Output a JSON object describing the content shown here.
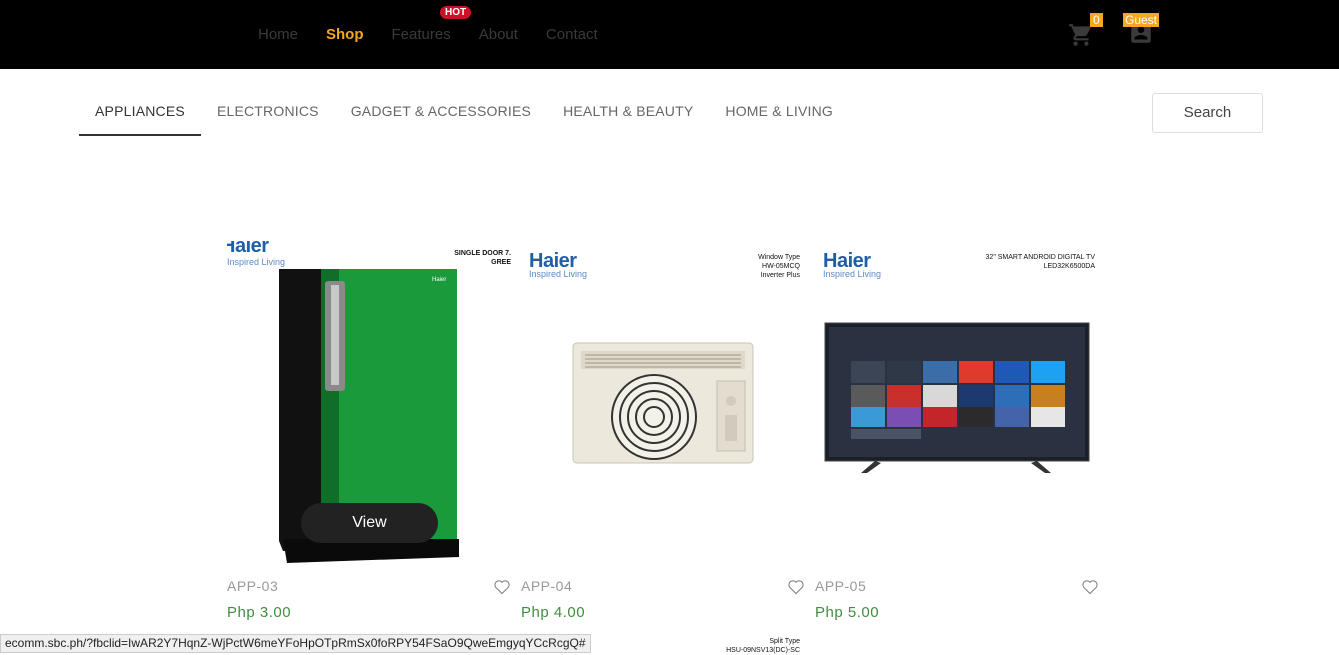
{
  "nav": {
    "items": [
      {
        "label": "Home"
      },
      {
        "label": "Shop"
      },
      {
        "label": "Features"
      },
      {
        "label": "About"
      },
      {
        "label": "Contact"
      }
    ],
    "badge": "HOT",
    "cart_count": "0",
    "user_label": "Guest"
  },
  "categories": [
    "APPLIANCES",
    "ELECTRONICS",
    "GADGET & ACCESSORIES",
    "HEALTH & BEAUTY",
    "HOME & LIVING"
  ],
  "search": {
    "label": "Search"
  },
  "products": [
    {
      "code": "APP-03",
      "price": "Php 3.00",
      "brand": "Haier",
      "tagline": "Inspired Living",
      "promo": "SINGLE DOOR 7.\nGREE"
    },
    {
      "code": "APP-04",
      "price": "Php 4.00",
      "brand": "Haier",
      "tagline": "Inspired Living",
      "promo": "Window Type\nHW-05MCQ\nInverter Plus"
    },
    {
      "code": "APP-05",
      "price": "Php 5.00",
      "brand": "Haier",
      "tagline": "Inspired Living",
      "promo": "32\" SMART ANDROID DIGITAL TV\nLED32K6500DA"
    }
  ],
  "view_button": "View",
  "next_row": {
    "promo": "Split Type\nHSU-09NSV13(DC)-SC"
  },
  "status_url": "ecomm.sbc.ph/?fbclid=IwAR2Y7HqnZ-WjPctW6meYFoHpOTpRmSx0foRPY54FSaO9QweEmgyqYCcRcgQ#",
  "colors": {
    "accent": "#f5a623",
    "hot": "#d0102a",
    "price": "#3f8f3f",
    "brand": "#1f5fa8"
  }
}
